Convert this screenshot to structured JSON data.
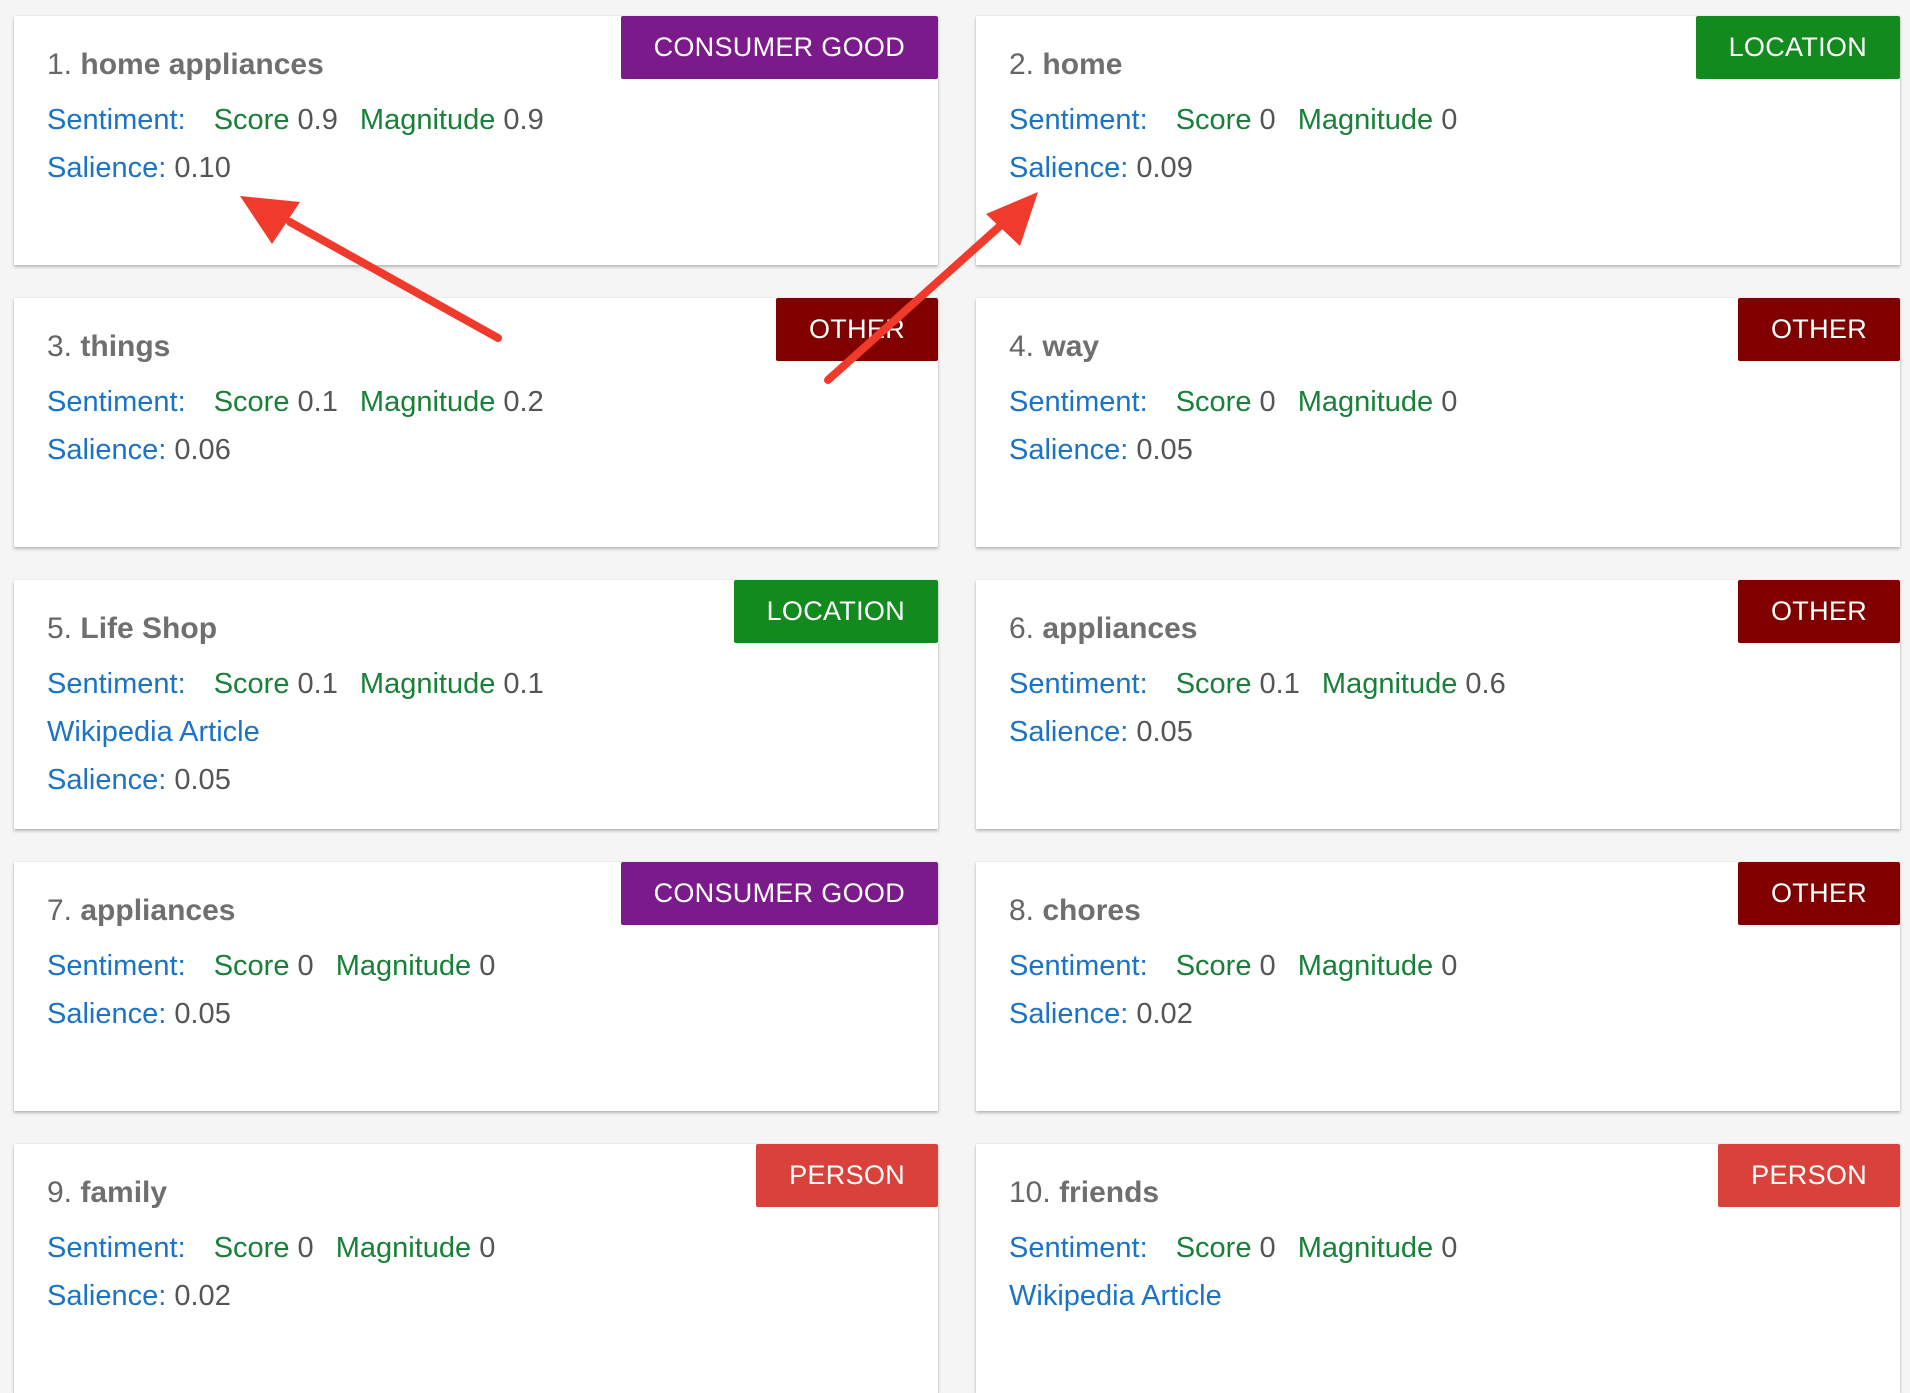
{
  "labels": {
    "sentiment": "Sentiment:",
    "score": "Score",
    "magnitude": "Magnitude",
    "salience": "Salience:",
    "wikipedia": "Wikipedia Article"
  },
  "colors": {
    "consumer_good": "#7b1a8b",
    "location": "#138a1e",
    "other": "#800000",
    "person": "#d9423b",
    "annotation_arrow": "#f03a2c"
  },
  "entities": [
    {
      "num": "1.",
      "name": "home appliances",
      "type": "CONSUMER GOOD",
      "score": "0.9",
      "magnitude": "0.9",
      "salience": "0.10"
    },
    {
      "num": "2.",
      "name": "home",
      "type": "LOCATION",
      "score": "0",
      "magnitude": "0",
      "salience": "0.09"
    },
    {
      "num": "3.",
      "name": "things",
      "type": "OTHER",
      "score": "0.1",
      "magnitude": "0.2",
      "salience": "0.06"
    },
    {
      "num": "4.",
      "name": "way",
      "type": "OTHER",
      "score": "0",
      "magnitude": "0",
      "salience": "0.05"
    },
    {
      "num": "5.",
      "name": "Life Shop",
      "type": "LOCATION",
      "score": "0.1",
      "magnitude": "0.1",
      "salience": "0.05"
    },
    {
      "num": "6.",
      "name": "appliances",
      "type": "OTHER",
      "score": "0.1",
      "magnitude": "0.6",
      "salience": "0.05"
    },
    {
      "num": "7.",
      "name": "appliances",
      "type": "CONSUMER GOOD",
      "score": "0",
      "magnitude": "0",
      "salience": "0.05"
    },
    {
      "num": "8.",
      "name": "chores",
      "type": "OTHER",
      "score": "0",
      "magnitude": "0",
      "salience": "0.02"
    },
    {
      "num": "9.",
      "name": "family",
      "type": "PERSON",
      "score": "0",
      "magnitude": "0",
      "salience": "0.02"
    },
    {
      "num": "10.",
      "name": "friends",
      "type": "PERSON",
      "score": "0",
      "magnitude": "0",
      "salience": ""
    }
  ]
}
